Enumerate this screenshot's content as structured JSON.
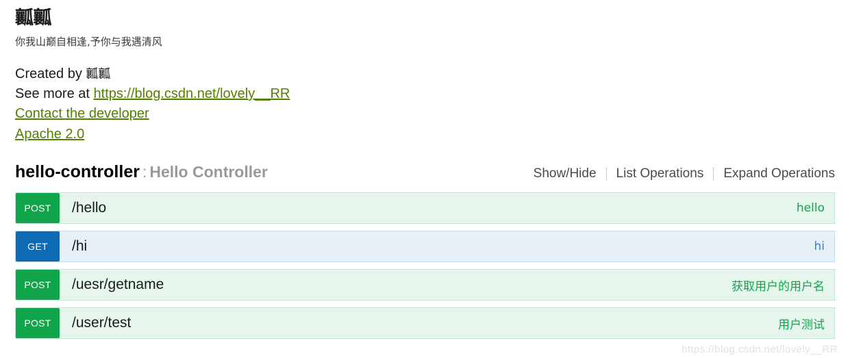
{
  "info": {
    "title": "瓤瓤",
    "subtitle": "你我山巅自相逢,予你与我遇清风",
    "created_by_prefix": "Created by ",
    "created_by_name": "瓤瓤",
    "see_more_prefix": "See more at ",
    "see_more_link": "https://blog.csdn.net/lovely__RR",
    "contact_link": "Contact the developer",
    "license_link": "Apache 2.0"
  },
  "resource": {
    "name": "hello-controller",
    "separator": ":",
    "description": "Hello Controller",
    "options": [
      {
        "label": "Show/Hide"
      },
      {
        "label": "List Operations"
      },
      {
        "label": "Expand Operations"
      }
    ]
  },
  "endpoints": [
    {
      "method": "POST",
      "method_class": "post",
      "path": "/hello",
      "description": "hello"
    },
    {
      "method": "GET",
      "method_class": "get",
      "path": "/hi",
      "description": "hi"
    },
    {
      "method": "POST",
      "method_class": "post",
      "path": "/uesr/getname",
      "description": "获取用户的用户名"
    },
    {
      "method": "POST",
      "method_class": "post",
      "path": "/user/test",
      "description": "用户测试"
    }
  ],
  "watermark": "https://blog.csdn.net/lovely__RR",
  "colors": {
    "post_badge": "#10a54a",
    "get_badge": "#0f6ab4",
    "post_row_bg": "#e7f6ec",
    "get_row_bg": "#e7f0f7",
    "link": "#547f00",
    "muted": "#999999"
  }
}
